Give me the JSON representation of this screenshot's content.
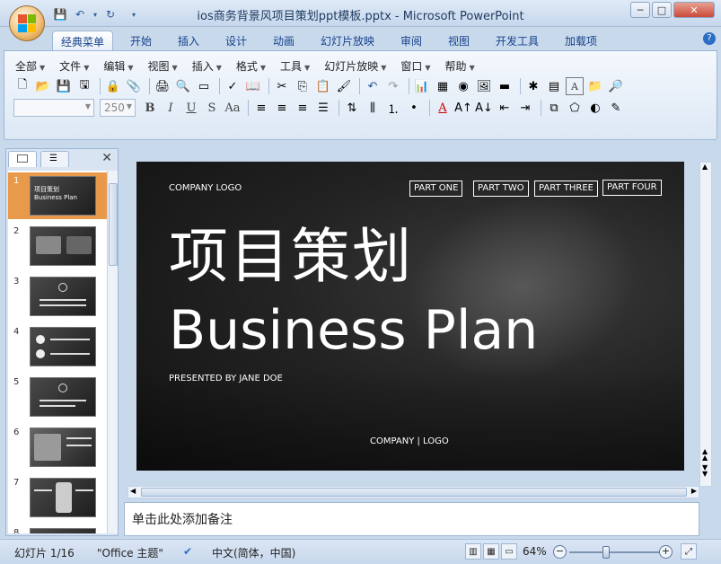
{
  "window": {
    "title": "ios商务背景风项目策划ppt模板.pptx - Microsoft PowerPoint",
    "minimize": "─",
    "maximize": "□",
    "close": "✕"
  },
  "ribbon_tabs": [
    "经典菜单",
    "开始",
    "插入",
    "设计",
    "动画",
    "幻灯片放映",
    "审阅",
    "视图",
    "开发工具",
    "加载项"
  ],
  "help": "?",
  "classic_menu": [
    "全部",
    "文件",
    "编辑",
    "视图",
    "插入",
    "格式",
    "工具",
    "幻灯片放映",
    "窗口",
    "帮助"
  ],
  "font_size": "250",
  "format_buttons": {
    "bold": "B",
    "italic": "I",
    "underline": "U",
    "strike": "S",
    "case": "Aa",
    "font_color": "A",
    "text_box": "A"
  },
  "panel": {
    "close": "✕"
  },
  "thumbnails": [
    {
      "num": "1",
      "text": "项目策划\nBusiness Plan"
    },
    {
      "num": "2",
      "text": ""
    },
    {
      "num": "3",
      "text": ""
    },
    {
      "num": "4",
      "text": ""
    },
    {
      "num": "5",
      "text": ""
    },
    {
      "num": "6",
      "text": ""
    },
    {
      "num": "7",
      "text": ""
    },
    {
      "num": "8",
      "text": ""
    }
  ],
  "slide": {
    "logo": "COMPANY LOGO",
    "parts": [
      "PART ONE",
      "PART TWO",
      "PART THREE",
      "PART FOUR"
    ],
    "title_cn": "项目策划",
    "title_en": "Business Plan",
    "presented": "PRESENTED BY JANE DOE",
    "footer": "COMPANY | LOGO"
  },
  "notes_placeholder": "单击此处添加备注",
  "status": {
    "slide_info": "幻灯片 1/16",
    "theme": "\"Office 主题\"",
    "language": "中文(简体，中国)",
    "zoom": "64%",
    "zoom_level": 0.4
  },
  "colors": {
    "accent": "#e89a4a",
    "ribbon": "#dde8f5",
    "frame": "#c9d9ec"
  }
}
